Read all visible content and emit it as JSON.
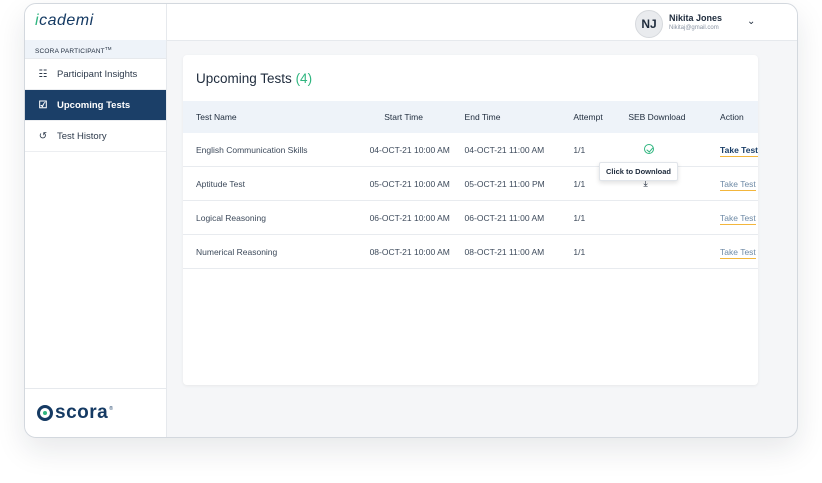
{
  "brand": {
    "logo_prefix": "i",
    "logo_rest": "cademi"
  },
  "user": {
    "initials": "NJ",
    "name": "Nikita Jones",
    "email": "Nikitaj@gmail.com"
  },
  "sidebar": {
    "role": "SCORA PARTICIPANT",
    "role_tm": "TM",
    "items": [
      {
        "label": "Participant Insights",
        "icon": "grid-icon"
      },
      {
        "label": "Upcoming Tests",
        "icon": "calendar-check-icon",
        "active": true
      },
      {
        "label": "Test History",
        "icon": "history-icon"
      }
    ],
    "footer_logo": "scora"
  },
  "main": {
    "title": "Upcoming Tests",
    "count": "(4)",
    "columns": [
      "Test Name",
      "Start Time",
      "End Time",
      "Attempt",
      "SEB Download",
      "Action"
    ],
    "rows": [
      {
        "name": "English Communication Skills",
        "start": "04-OCT-21 10:00 AM",
        "end": "04-OCT-21 11:00 AM",
        "attempt": "1/1",
        "seb": "downloaded",
        "action": "Take Test"
      },
      {
        "name": "Aptitude Test",
        "start": "05-OCT-21 10:00 AM",
        "end": "05-OCT-21 11:00 PM",
        "attempt": "1/1",
        "seb": "download",
        "action": "Take Test"
      },
      {
        "name": "Logical Reasoning",
        "start": "06-OCT-21 10:00 AM",
        "end": "06-OCT-21 11:00 AM",
        "attempt": "1/1",
        "seb": "",
        "action": "Take Test"
      },
      {
        "name": "Numerical Reasoning",
        "start": "08-OCT-21 10:00 AM",
        "end": "08-OCT-21 11:00 AM",
        "attempt": "1/1",
        "seb": "",
        "action": "Take Test"
      }
    ],
    "tooltip": "Click to Download"
  },
  "colors": {
    "navy": "#1b3f68",
    "green": "#2fb57f",
    "accent_underline": "#f3b63c"
  }
}
